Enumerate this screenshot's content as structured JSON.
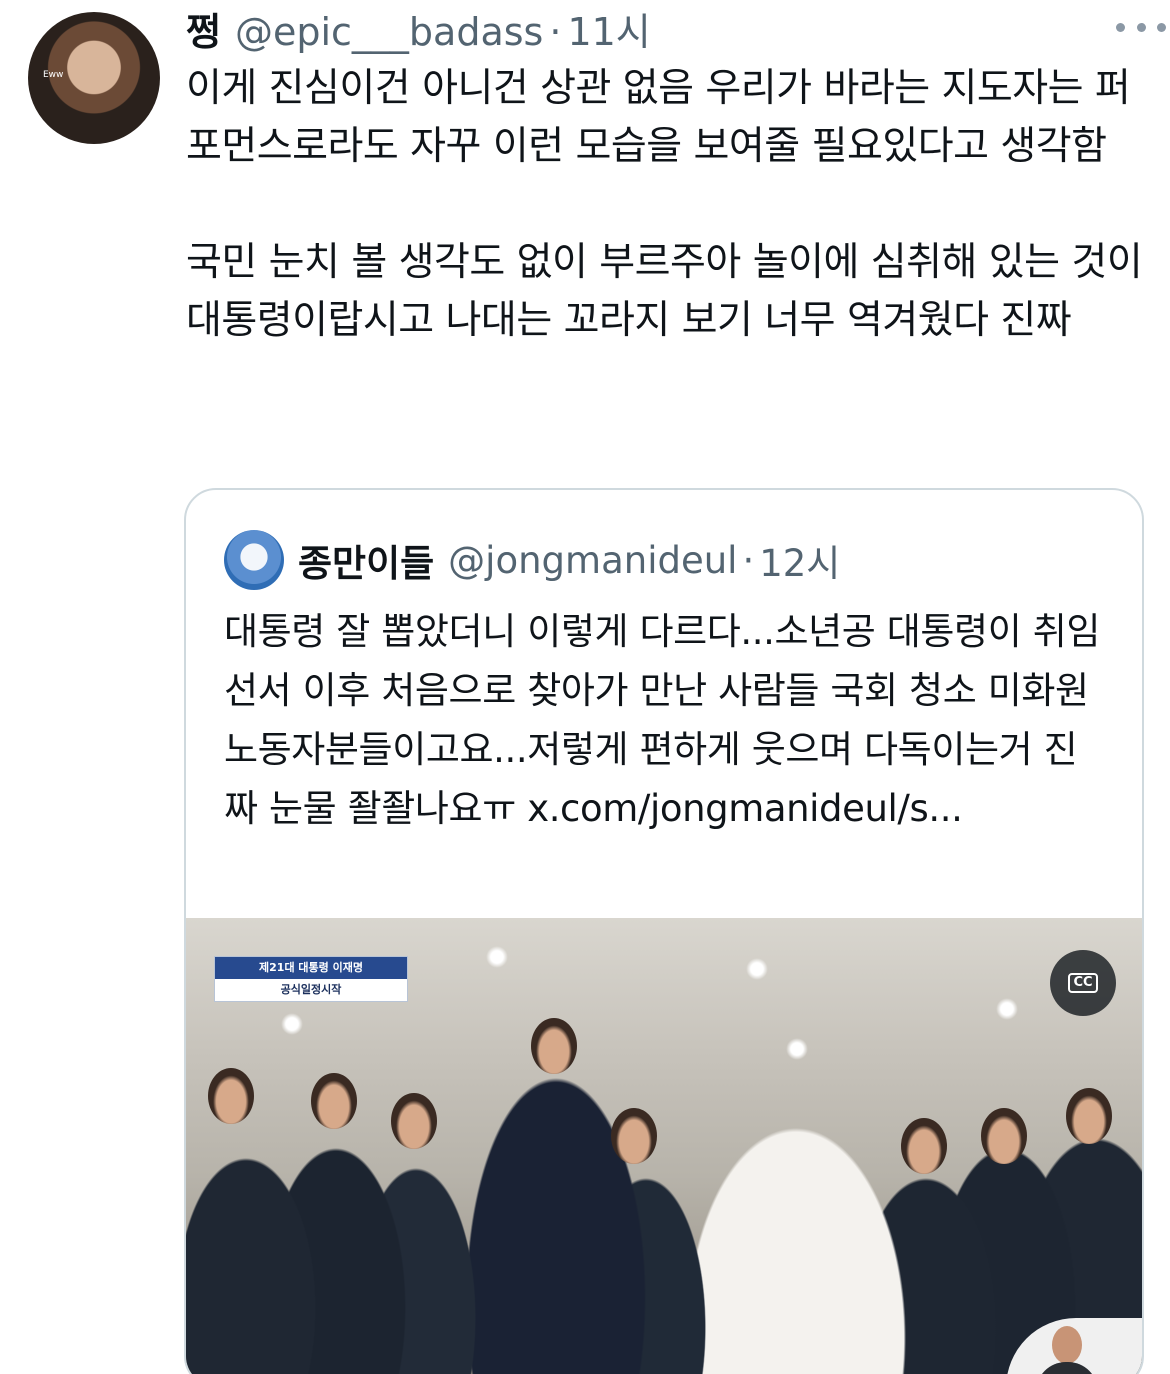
{
  "tweet": {
    "display_name": "쩡",
    "handle": "@epic___badass",
    "separator": "·",
    "time": "11시",
    "avatar_caption": "Eww",
    "paragraphs": [
      "이게 진심이건 아니건 상관 없음 우리가 바라는 지도자는 퍼포먼스로라도 자꾸 이런 모습을 보여줄 필요있다고 생각함",
      "국민 눈치 볼 생각도 없이 부르주아 놀이에 심취해 있는 것이 대통령이랍시고 나대는 꼬라지 보기 너무 역겨웠다 진짜"
    ]
  },
  "quoted_tweet": {
    "display_name": "종만이들",
    "handle": "@jongmanideul",
    "separator": "·",
    "time": "12시",
    "text": "대통령 잘 뽑았더니 이렇게 다르다...소년공 대통령이 취임선서 이후 처음으로 찾아가 만난 사람들 국회 청소 미화원 노동자분들이고요...저렇게 편하게 웃으며 다독이는거 진짜 눈물 좔좔나요ㅠ x.com/jongmanideul/s...",
    "media": {
      "banner_line1": "제21대 대통령 이재명",
      "banner_line2": "공식일정시작",
      "cc_label": "CC"
    }
  },
  "colors": {
    "text": "#0f1419",
    "secondary": "#536471",
    "border": "#cfd9de"
  },
  "icons": {
    "more": "more-horizontal-icon",
    "captions": "closed-captions-icon"
  }
}
